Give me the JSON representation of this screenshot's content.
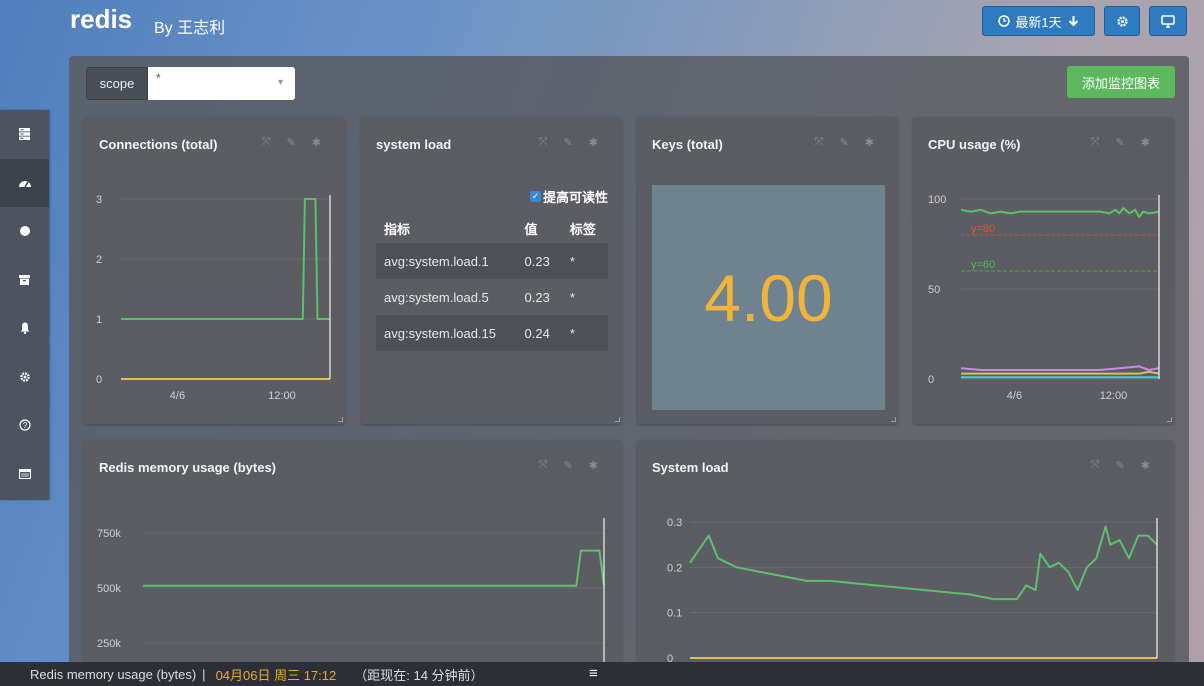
{
  "header": {
    "title": "redis",
    "author": "By 王志利",
    "time_range_label": "最新1天",
    "settings_icon": "gear-icon",
    "display_icon": "monitor-icon"
  },
  "sidebar": {
    "items": [
      {
        "icon": "server-icon"
      },
      {
        "icon": "dashboard-icon",
        "active": true
      },
      {
        "icon": "circle-icon"
      },
      {
        "icon": "archive-icon"
      },
      {
        "icon": "bell-icon"
      },
      {
        "icon": "gear-icon"
      },
      {
        "icon": "help-icon"
      },
      {
        "icon": "window-icon"
      }
    ]
  },
  "toolbar": {
    "scope_label": "scope",
    "scope_value": "*",
    "add_chart_label": "添加监控图表"
  },
  "panels": {
    "connections": {
      "title": "Connections (total)"
    },
    "system_load_table": {
      "title": "system load",
      "readable_label": "提高可读性",
      "columns": [
        "指标",
        "值",
        "标签"
      ],
      "rows": [
        [
          "avg:system.load.1",
          "0.23",
          "*"
        ],
        [
          "avg:system.load.5",
          "0.23",
          "*"
        ],
        [
          "avg:system.load.15",
          "0.24",
          "*"
        ]
      ]
    },
    "keys": {
      "title": "Keys (total)",
      "value": "4.00"
    },
    "cpu": {
      "title": "CPU usage (%)",
      "threshold_80": "y=80",
      "threshold_60": "y=60"
    },
    "memory": {
      "title": "Redis memory usage (bytes)"
    },
    "system_load_chart": {
      "title": "System load"
    }
  },
  "colors": {
    "line_green": "#5cc06a",
    "line_yellow": "#e0c050",
    "line_purple": "#c58be8",
    "line_cyan": "#4ec9d8",
    "threshold_red": "#e0542e",
    "threshold_green": "#4cbb4c",
    "keys_value": "#f0b43a"
  },
  "footer": {
    "chart_name": "Redis memory usage (bytes)",
    "separator": "|",
    "timestamp": "04月06日 周三 17:12",
    "relative": "（距现在:  14 分钟前）"
  },
  "chart_data": [
    {
      "id": "connections",
      "type": "line",
      "x_ticks": [
        "4/6",
        "12:00"
      ],
      "y_ticks": [
        0,
        1,
        2,
        3
      ],
      "ylim": [
        0,
        3
      ],
      "series": [
        {
          "color": "#5cc06a",
          "x": [
            0,
            0.86,
            0.87,
            0.88,
            0.92,
            0.93,
            0.94,
            0.95,
            1.0
          ],
          "values": [
            1,
            1,
            1,
            3,
            3,
            3,
            1,
            1,
            1
          ]
        },
        {
          "color": "#e0c050",
          "x": [
            0,
            1.0
          ],
          "values": [
            0,
            0
          ]
        }
      ]
    },
    {
      "id": "cpu",
      "type": "line",
      "x_ticks": [
        "4/6",
        "12:00"
      ],
      "y_ticks": [
        0,
        50,
        100
      ],
      "ylim": [
        0,
        100
      ],
      "series": [
        {
          "color": "#5cc06a",
          "x": [
            0,
            0.05,
            0.1,
            0.15,
            0.2,
            0.25,
            0.3,
            0.35,
            0.4,
            0.5,
            0.6,
            0.7,
            0.75,
            0.78,
            0.8,
            0.82,
            0.85,
            0.88,
            0.9,
            0.92,
            0.95,
            1.0
          ],
          "values": [
            94,
            93,
            94,
            92,
            93,
            92,
            93,
            93,
            93,
            93,
            93,
            93,
            92,
            94,
            92,
            95,
            92,
            94,
            90,
            93,
            92,
            93
          ]
        },
        {
          "color": "#c58be8",
          "x": [
            0,
            0.1,
            0.3,
            0.5,
            0.7,
            0.8,
            0.9,
            0.95,
            1.0
          ],
          "values": [
            6,
            5,
            5,
            5,
            5,
            6,
            7,
            5,
            6
          ]
        },
        {
          "color": "#4ec9d8",
          "x": [
            0,
            1.0
          ],
          "values": [
            1,
            1
          ]
        },
        {
          "color": "#e0c050",
          "x": [
            0,
            0.9,
            0.95,
            1.0
          ],
          "values": [
            3,
            3,
            4,
            3
          ]
        }
      ],
      "thresholds": [
        {
          "label": "y=80",
          "value": 80,
          "color": "#e0542e"
        },
        {
          "label": "y=60",
          "value": 60,
          "color": "#4cbb4c"
        }
      ]
    },
    {
      "id": "memory",
      "type": "line",
      "y_ticks": [
        "250k",
        "500k",
        "750k"
      ],
      "ylim": [
        150000,
        800000
      ],
      "series": [
        {
          "color": "#5cc06a",
          "x": [
            0,
            0.92,
            0.94,
            0.95,
            0.99,
            1.0
          ],
          "values": [
            510000,
            510000,
            510000,
            670000,
            670000,
            510000
          ]
        }
      ]
    },
    {
      "id": "system_load",
      "type": "line",
      "y_ticks": [
        0,
        0.1,
        0.2,
        0.3
      ],
      "ylim": [
        0,
        0.3
      ],
      "series": [
        {
          "color": "#5cc06a",
          "x": [
            0,
            0.04,
            0.06,
            0.1,
            0.15,
            0.2,
            0.25,
            0.3,
            0.4,
            0.5,
            0.6,
            0.65,
            0.7,
            0.72,
            0.74,
            0.75,
            0.77,
            0.79,
            0.81,
            0.83,
            0.85,
            0.87,
            0.89,
            0.9,
            0.92,
            0.94,
            0.96,
            0.98,
            1.0
          ],
          "values": [
            0.21,
            0.27,
            0.22,
            0.2,
            0.19,
            0.18,
            0.17,
            0.17,
            0.16,
            0.15,
            0.14,
            0.13,
            0.13,
            0.16,
            0.15,
            0.23,
            0.2,
            0.21,
            0.19,
            0.15,
            0.2,
            0.22,
            0.29,
            0.25,
            0.26,
            0.22,
            0.27,
            0.27,
            0.25
          ]
        },
        {
          "color": "#e0c050",
          "x": [
            0,
            1.0
          ],
          "values": [
            0,
            0
          ]
        }
      ]
    }
  ]
}
